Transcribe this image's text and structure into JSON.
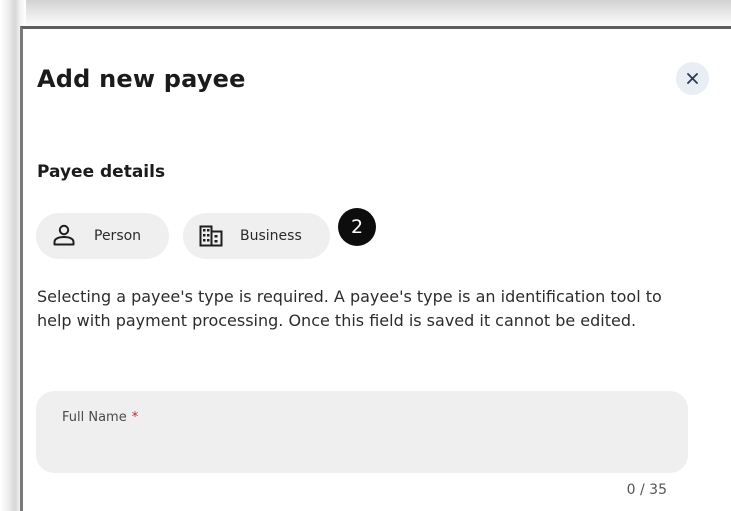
{
  "dialog": {
    "title": "Add new payee",
    "close_icon": "close-icon"
  },
  "payee_details": {
    "heading": "Payee details",
    "types": [
      {
        "label": "Person",
        "icon": "person-icon"
      },
      {
        "label": "Business",
        "icon": "building-icon"
      }
    ],
    "step_badge": "2",
    "help_text": "Selecting a payee's type is required. A payee's type is an identification tool to help with payment processing. Once this field is saved it cannot be edited."
  },
  "full_name_field": {
    "label": "Full Name",
    "required_marker": "*",
    "value": "",
    "counter": "0 / 35"
  },
  "colors": {
    "accent_badge": "#0d0d0d",
    "chip_background": "#efefef",
    "close_button_background": "#e9edf4",
    "required_star": "#c62828"
  }
}
